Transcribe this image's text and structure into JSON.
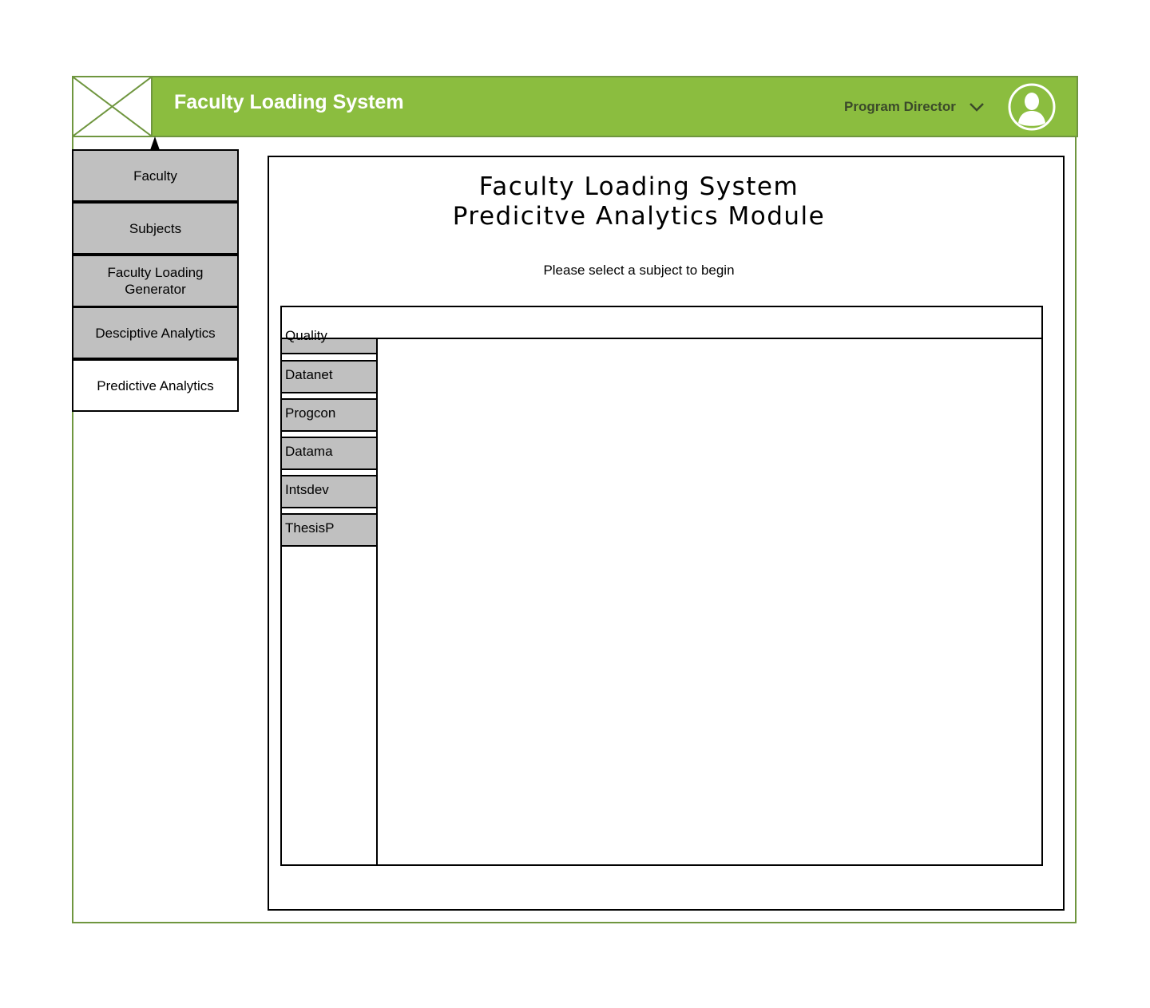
{
  "header": {
    "app_title": "Faculty Loading System",
    "user_role": "Program Director",
    "accent_color": "#8bbd3f",
    "border_color": "#6f963f"
  },
  "sidebar": {
    "items": [
      {
        "label": "Faculty",
        "active": false
      },
      {
        "label": "Subjects",
        "active": false
      },
      {
        "label": "Faculty Loading Generator",
        "active": false
      },
      {
        "label": "Desciptive Analytics",
        "active": false
      },
      {
        "label": "Predictive Analytics",
        "active": true
      }
    ]
  },
  "main": {
    "title_line1": "Faculty Loading System",
    "title_line2": "Predicitve Analytics Module",
    "instruction": "Please select a subject to begin",
    "subjects": [
      "Quality",
      "Datanet",
      "Progcon",
      "Datama",
      "Intsdev",
      "ThesisP"
    ]
  },
  "icons": {
    "logo": "image-placeholder-icon",
    "dropdown": "chevron-down-icon",
    "avatar": "user-avatar-icon"
  }
}
